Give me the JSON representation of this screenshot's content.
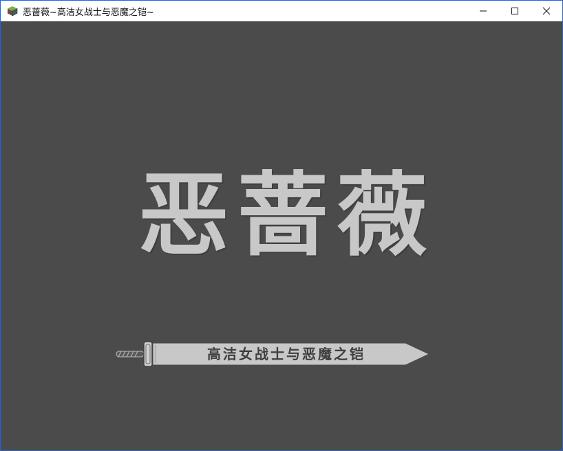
{
  "window": {
    "title": "恶蔷薇~高洁女战士与恶魔之铠~",
    "icon": "app-cube-icon",
    "controls": [
      "minimize-icon",
      "maximize-icon",
      "close-icon"
    ]
  },
  "title_screen": {
    "logo_chars": [
      "恶",
      "蔷",
      "薇"
    ],
    "subtitle": "高洁女战士与恶魔之铠",
    "background_color": "#4b4b4b",
    "logo_color": "#c8c8c8"
  }
}
